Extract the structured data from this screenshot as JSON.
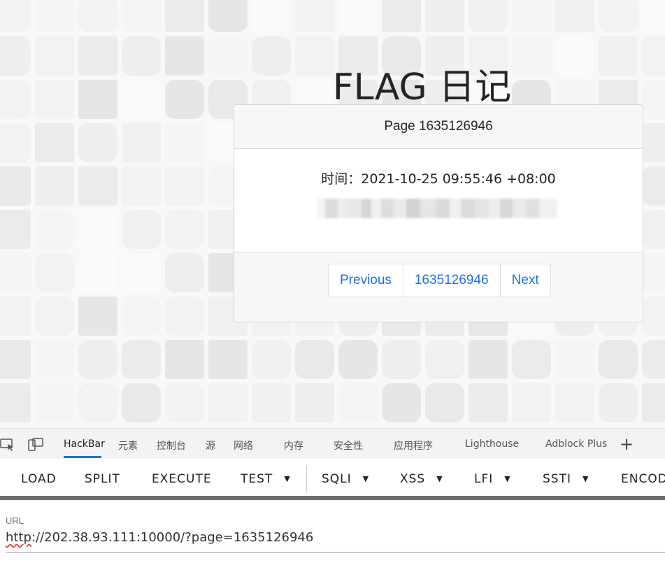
{
  "page": {
    "title": "FLAG 日记",
    "card": {
      "header": "Page 1635126946",
      "time_text": "时间：2021-10-25 09:55:46 +08:00"
    },
    "pagination": {
      "previous": "Previous",
      "current": "1635126946",
      "next": "Next"
    }
  },
  "devtools": {
    "tabs": [
      "HackBar",
      "元素",
      "控制台",
      "源",
      "网络",
      "内存",
      "安全性",
      "应用程序",
      "Lighthouse",
      "Adblock Plus"
    ],
    "active_tab": "HackBar",
    "add_tab": "+"
  },
  "hackbar": {
    "buttons": [
      "LOAD",
      "SPLIT",
      "EXECUTE",
      "TEST",
      "SQLI",
      "XSS",
      "LFI",
      "SSTI",
      "ENCODING"
    ],
    "url_label": "URL",
    "url_scheme": "http",
    "url_rest": "://202.38.93.111:10000/?page=1635126946"
  },
  "colors": {
    "link": "#1a73e8",
    "active_tab_underline": "#1a73e8",
    "hackbar_divider": "#6e6e6e"
  }
}
